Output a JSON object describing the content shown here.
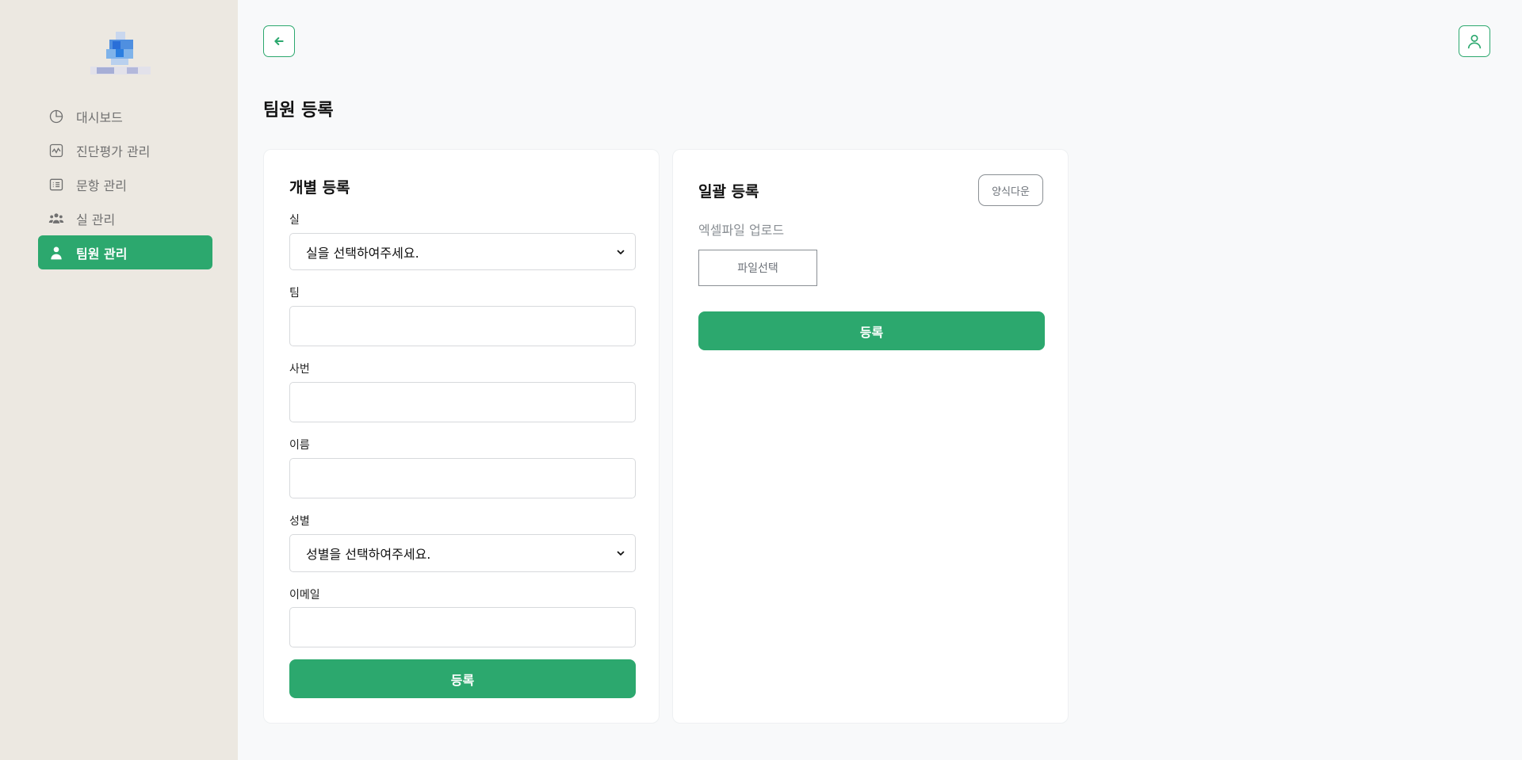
{
  "sidebar": {
    "items": [
      {
        "label": "대시보드",
        "icon": "pie-chart-icon"
      },
      {
        "label": "진단평가 관리",
        "icon": "activity-chart-icon"
      },
      {
        "label": "문항 관리",
        "icon": "list-icon"
      },
      {
        "label": "실 관리",
        "icon": "users-icon"
      },
      {
        "label": "팀원 관리",
        "icon": "user-icon",
        "active": true
      }
    ]
  },
  "header": {
    "back_icon": "arrow-left-icon",
    "user_icon": "user-profile-icon"
  },
  "page": {
    "title": "팀원 등록"
  },
  "individual": {
    "title": "개별 등록",
    "fields": {
      "room": {
        "label": "실",
        "value": "실을 선택하여주세요."
      },
      "team": {
        "label": "팀",
        "value": ""
      },
      "employee_no": {
        "label": "사번",
        "value": ""
      },
      "name": {
        "label": "이름",
        "value": ""
      },
      "gender": {
        "label": "성별",
        "value": "성별을 선택하여주세요."
      },
      "email": {
        "label": "이메일",
        "value": ""
      }
    },
    "submit_label": "등록"
  },
  "bulk": {
    "title": "일괄 등록",
    "template_label": "양식다운",
    "upload_label": "엑셀파일 업로드",
    "file_label": "파일선택",
    "submit_label": "등록"
  },
  "colors": {
    "accent": "#2ca86e",
    "sidebar_bg": "#ece8e1",
    "page_bg": "#f8f9fa"
  }
}
